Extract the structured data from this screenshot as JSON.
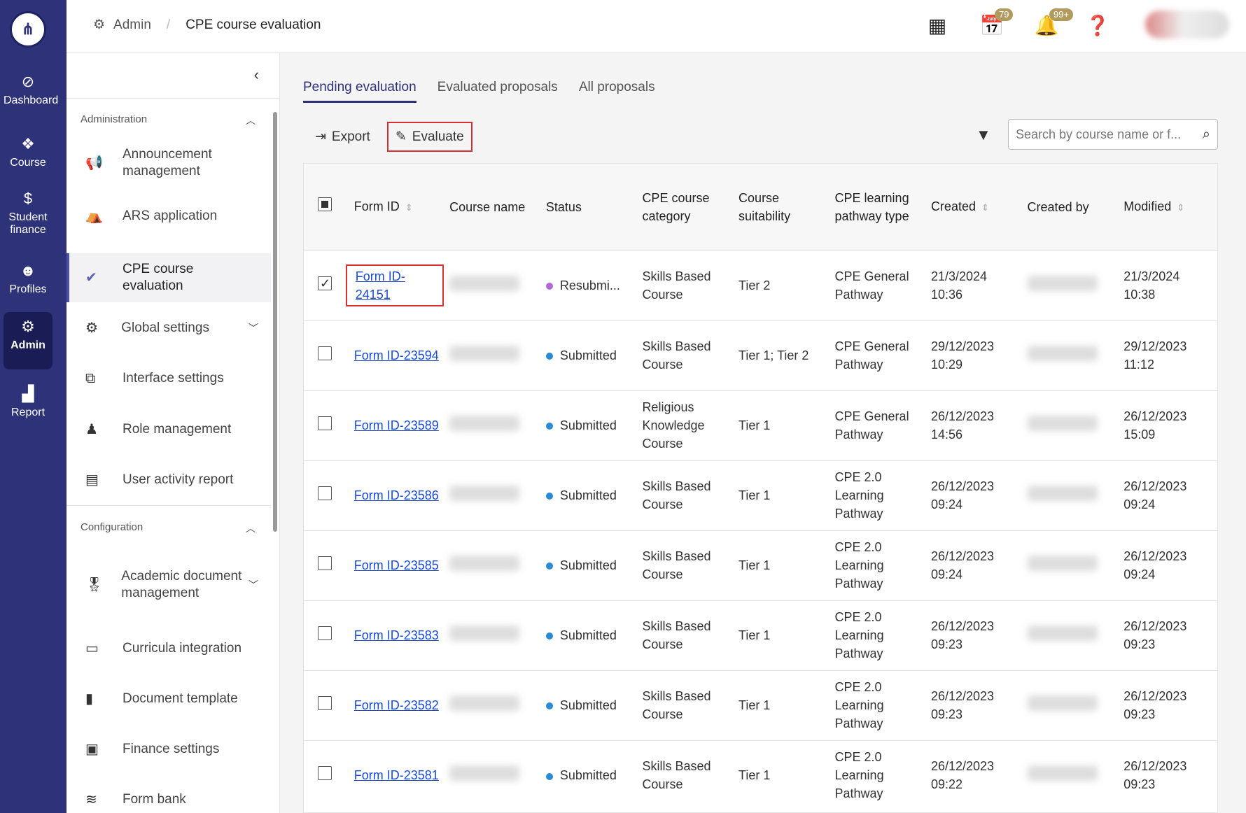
{
  "rail": {
    "items": [
      {
        "label": "Dashboard",
        "icon": "compass-icon"
      },
      {
        "label": "Course",
        "icon": "cubes-icon"
      },
      {
        "label": "Student finance",
        "icon": "dollar-icon"
      },
      {
        "label": "Profiles",
        "icon": "users-icon"
      },
      {
        "label": "Admin",
        "icon": "user-gear-icon"
      },
      {
        "label": "Report",
        "icon": "area-chart-icon"
      }
    ]
  },
  "topbar": {
    "breadcrumb_root": "Admin",
    "breadcrumb_current": "CPE course evaluation",
    "calendar_badge": "79",
    "bell_badge": "99+"
  },
  "sidebar": {
    "section1": "Administration",
    "section2": "Configuration",
    "items": [
      {
        "label": "Announcement management"
      },
      {
        "label": "ARS application"
      },
      {
        "label": "CPE course evaluation"
      },
      {
        "label": "Global settings"
      },
      {
        "label": "Interface settings"
      },
      {
        "label": "Role management"
      },
      {
        "label": "User activity report"
      },
      {
        "label": "Academic document management"
      },
      {
        "label": "Curricula integration"
      },
      {
        "label": "Document template"
      },
      {
        "label": "Finance settings"
      },
      {
        "label": "Form bank"
      }
    ]
  },
  "tabs": [
    "Pending evaluation",
    "Evaluated proposals",
    "All proposals"
  ],
  "toolbar": {
    "export": "Export",
    "evaluate": "Evaluate",
    "search_placeholder": "Search by course name or f..."
  },
  "table": {
    "headers": [
      "Form ID",
      "Course name",
      "Status",
      "CPE course category",
      "Course suitability",
      "CPE learning pathway type",
      "Created",
      "Created by",
      "Modified"
    ],
    "rows": [
      {
        "id": "Form ID-24151",
        "status": "Resubmi...",
        "category": "Skills Based Course",
        "suit": "Tier 2",
        "path": "CPE General Pathway",
        "created": "21/3/2024 10:36",
        "modified": "21/3/2024 10:38"
      },
      {
        "id": "Form ID-23594",
        "status": "Submitted",
        "category": "Skills Based Course",
        "suit": "Tier 1; Tier 2",
        "path": "CPE General Pathway",
        "created": "29/12/2023 10:29",
        "modified": "29/12/2023 11:12"
      },
      {
        "id": "Form ID-23589",
        "status": "Submitted",
        "category": "Religious Knowledge Course",
        "suit": "Tier 1",
        "path": "CPE General Pathway",
        "created": "26/12/2023 14:56",
        "modified": "26/12/2023 15:09"
      },
      {
        "id": "Form ID-23586",
        "status": "Submitted",
        "category": "Skills Based Course",
        "suit": "Tier 1",
        "path": "CPE 2.0 Learning Pathway",
        "created": "26/12/2023 09:24",
        "modified": "26/12/2023 09:24"
      },
      {
        "id": "Form ID-23585",
        "status": "Submitted",
        "category": "Skills Based Course",
        "suit": "Tier 1",
        "path": "CPE 2.0 Learning Pathway",
        "created": "26/12/2023 09:24",
        "modified": "26/12/2023 09:24"
      },
      {
        "id": "Form ID-23583",
        "status": "Submitted",
        "category": "Skills Based Course",
        "suit": "Tier 1",
        "path": "CPE 2.0 Learning Pathway",
        "created": "26/12/2023 09:23",
        "modified": "26/12/2023 09:23"
      },
      {
        "id": "Form ID-23582",
        "status": "Submitted",
        "category": "Skills Based Course",
        "suit": "Tier 1",
        "path": "CPE 2.0 Learning Pathway",
        "created": "26/12/2023 09:23",
        "modified": "26/12/2023 09:23"
      },
      {
        "id": "Form ID-23581",
        "status": "Submitted",
        "category": "Skills Based Course",
        "suit": "Tier 1",
        "path": "CPE 2.0 Learning Pathway",
        "created": "26/12/2023 09:22",
        "modified": "26/12/2023 09:23"
      }
    ]
  }
}
